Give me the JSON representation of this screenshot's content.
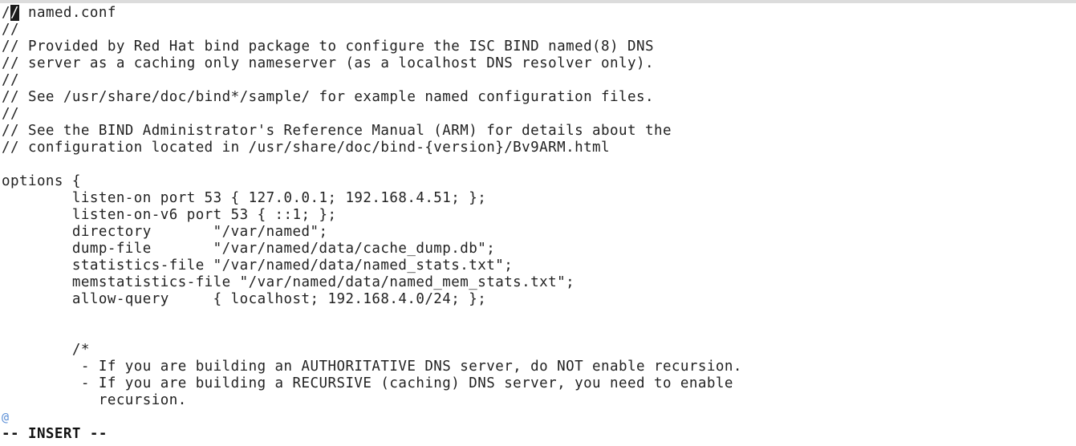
{
  "editor": {
    "mode": "INSERT",
    "status_text": "-- INSERT --",
    "cursor_char": "/",
    "lines": [
      "/",
      "//",
      "// Provided by Red Hat bind package to configure the ISC BIND named(8) DNS",
      "// server as a caching only nameserver (as a localhost DNS resolver only).",
      "//",
      "// See /usr/share/doc/bind*/sample/ for example named configuration files.",
      "//",
      "// See the BIND Administrator's Reference Manual (ARM) for details about the",
      "// configuration located in /usr/share/doc/bind-{version}/Bv9ARM.html",
      "",
      "options {",
      "        listen-on port 53 { 127.0.0.1; 192.168.4.51; };",
      "        listen-on-v6 port 53 { ::1; };",
      "        directory       \"/var/named\";",
      "        dump-file       \"/var/named/data/cache_dump.db\";",
      "        statistics-file \"/var/named/data/named_stats.txt\";",
      "        memstatistics-file \"/var/named/data/named_mem_stats.txt\";",
      "        allow-query     { localhost; 192.168.4.0/24; };",
      "",
      "",
      "        /*",
      "         - If you are building an AUTHORITATIVE DNS server, do NOT enable recursion.",
      "         - If you are building a RECURSIVE (caching) DNS server, you need to enable",
      "           recursion."
    ],
    "first_line_rest": " named.conf",
    "continuation_marker": "@"
  }
}
